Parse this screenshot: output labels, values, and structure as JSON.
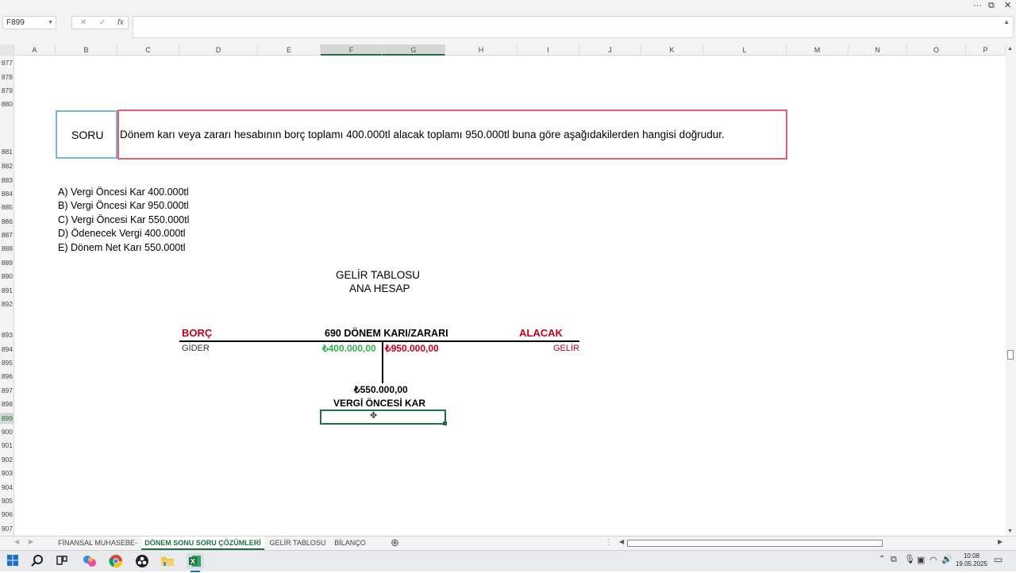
{
  "window": {
    "more": "···",
    "restore": "⧉",
    "close": "✕"
  },
  "formula_bar": {
    "name_box": "F899",
    "cancel": "✕",
    "enter": "✓",
    "fx": "fx",
    "value": ""
  },
  "columns": [
    "A",
    "B",
    "C",
    "D",
    "E",
    "F",
    "G",
    "H",
    "I",
    "J",
    "K",
    "L",
    "M",
    "N",
    "O",
    "P"
  ],
  "rows": [
    "877",
    "878",
    "879",
    "880",
    "881",
    "882",
    "883",
    "884",
    "885",
    "886",
    "887",
    "888",
    "889",
    "890",
    "891",
    "892",
    "893",
    "894",
    "895",
    "896",
    "897",
    "898",
    "899",
    "900",
    "901",
    "902",
    "903",
    "904",
    "905",
    "906",
    "907"
  ],
  "selected_cell": {
    "column": "F",
    "row": "899"
  },
  "content": {
    "soru_label": "SORU",
    "question": "Dönem karı veya zararı hesabının borç toplamı 400.000tl alacak toplamı 950.000tl buna göre aşağıdakilerden hangisi doğrudur.",
    "options": [
      "A) Vergi Öncesi Kar 400.000tl",
      "B) Vergi Öncesi Kar 950.000tl",
      "C) Vergi Öncesi Kar 550.000tl",
      "D) Ödenecek Vergi  400.000tl",
      "E) Dönem Net  Karı 550.000tl"
    ],
    "table_title_1": "GELİR TABLOSU",
    "table_title_2": "ANA HESAP",
    "borc": "BORÇ",
    "account": "690 DÖNEM KARI/ZARARI",
    "alacak": "ALACAK",
    "gider": "GİDER",
    "debit_amount": "₺400.000,00",
    "credit_amount": "₺950.000,00",
    "gelir": "GELİR",
    "result_amount": "₺550.000,00",
    "result_label": "VERGİ ÖNCESİ KAR"
  },
  "colors": {
    "red": "#c0001d",
    "green": "#2eb04e",
    "excel_green": "#1e7145"
  },
  "sheet_tabs": [
    "FİNANSAL MUHASEBE-",
    "DÖNEM SONU SORU ÇÖZÜMLERİ",
    "GELİR TABLOSU",
    "BİLANÇO"
  ],
  "active_tab": "DÖNEM SONU SORU ÇÖZÜMLERİ",
  "add_sheet": "⊕",
  "taskbar": {
    "icons": [
      "windows-start-icon",
      "search-icon",
      "task-view-icon",
      "copilot-icon",
      "chrome-icon",
      "obs-icon",
      "file-explorer-icon",
      "excel-icon"
    ],
    "time": "10:08",
    "date": "19.05.2025"
  }
}
